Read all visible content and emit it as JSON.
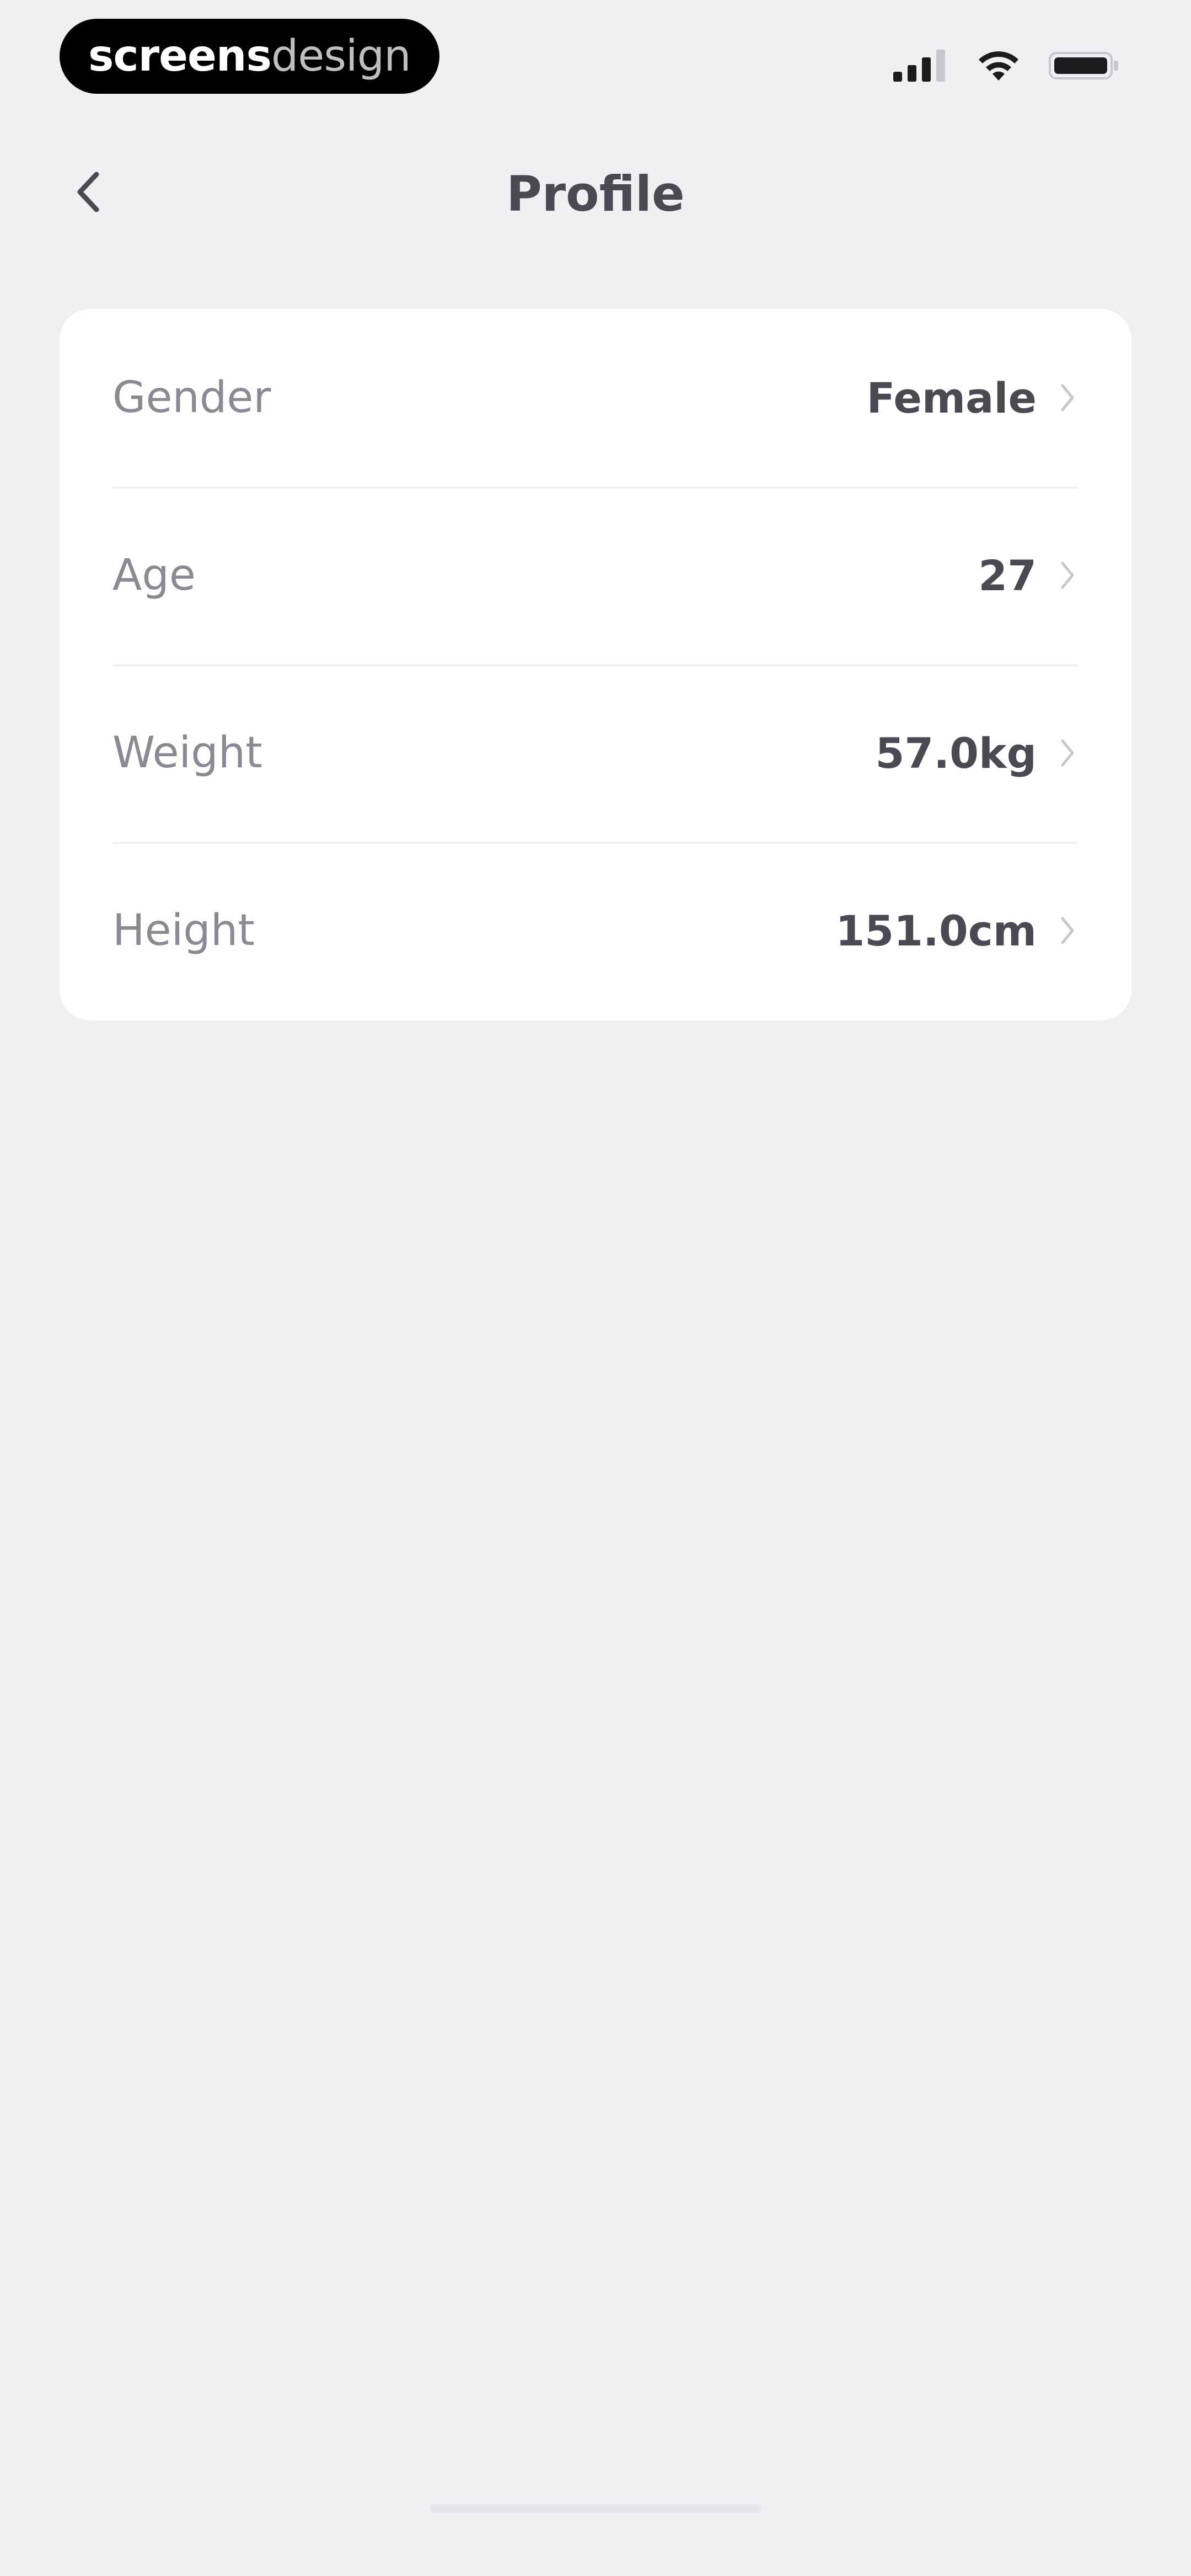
{
  "status_bar": {
    "brand_strong": "screens",
    "brand_light": "design",
    "icons": [
      "cellular-signal-icon",
      "wifi-icon",
      "battery-icon"
    ]
  },
  "nav": {
    "title": "Profile",
    "back_icon": "chevron-left-icon"
  },
  "profile": {
    "rows": [
      {
        "label": "Gender",
        "value": "Female"
      },
      {
        "label": "Age",
        "value": "27"
      },
      {
        "label": "Weight",
        "value": "57.0kg"
      },
      {
        "label": "Height",
        "value": "151.0cm"
      }
    ]
  },
  "colors": {
    "background": "#f0f0f2",
    "card": "#ffffff",
    "label": "#8a8a92",
    "value": "#4a4a52",
    "chevron": "#c8c8cc"
  }
}
